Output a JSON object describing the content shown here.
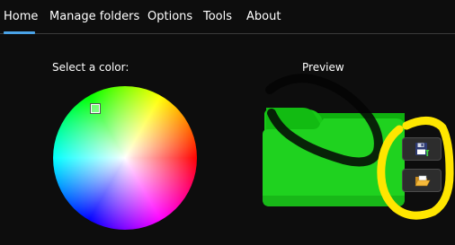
{
  "nav": {
    "tabs": [
      {
        "label": "Home"
      },
      {
        "label": "Manage folders"
      },
      {
        "label": "Options"
      },
      {
        "label": "Tools"
      },
      {
        "label": "About"
      }
    ],
    "active_tab": "Home",
    "accent_color": "#4aa3e8"
  },
  "color_picker": {
    "label": "Select a color:"
  },
  "preview": {
    "label": "Preview",
    "folder_color": "#1fd21f"
  },
  "actions": {
    "save_icon": "save-floppy-icon",
    "open_icon": "open-folder-icon"
  },
  "annotation": {
    "color": "#ffe600"
  }
}
